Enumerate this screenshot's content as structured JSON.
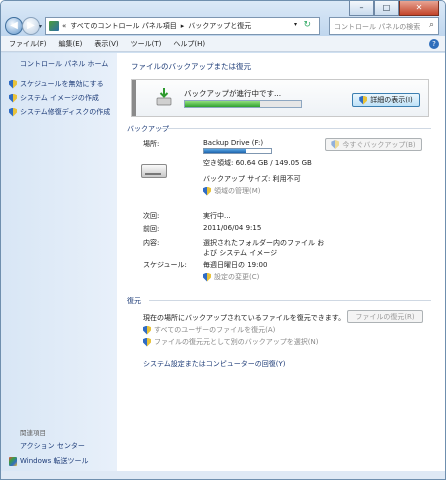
{
  "address": {
    "crumbs": [
      "«",
      "すべてのコントロール パネル項目",
      "▸",
      "バックアップと復元"
    ]
  },
  "search": {
    "placeholder": "コントロール パネルの検索"
  },
  "menu": [
    "ファイル(F)",
    "編集(E)",
    "表示(V)",
    "ツール(T)",
    "ヘルプ(H)"
  ],
  "sidebar": {
    "home": "コントロール パネル ホーム",
    "links": [
      "スケジュールを無効にする",
      "システム イメージの作成",
      "システム修復ディスクの作成"
    ],
    "related_title": "関連項目",
    "related": [
      "アクション センター",
      "Windows 転送ツール"
    ]
  },
  "main": {
    "title": "ファイルのバックアップまたは復元",
    "progress": {
      "message": "バックアップが進行中です...",
      "fraction": 0.65,
      "details_button": "詳細の表示(I)"
    },
    "backup": {
      "heading": "バックアップ",
      "location_label": "場所:",
      "drive_name": "Backup Drive (F:)",
      "capacity_used_fraction": 0.62,
      "free_space": "空き領域: 60.64 GB / 149.05 GB",
      "backup_size": "バックアップ サイズ: 利用不可",
      "manage_space": "領域の管理(M)",
      "backup_now_button": "今すぐバックアップ(B)",
      "next_label": "次回:",
      "next_value": "実行中...",
      "last_label": "前回:",
      "last_value": "2011/06/04 9:15",
      "contents_label": "内容:",
      "contents_value_1": "選択されたフォルダー内のファイル お",
      "contents_value_2": "よび システム イメージ",
      "schedule_label": "スケジュール:",
      "schedule_value": "毎週日曜日の 19:00",
      "change_settings": "設定の変更(C)"
    },
    "restore": {
      "heading": "復元",
      "description": "現在の場所にバックアップされているファイルを復元できます。",
      "restore_button": "ファイルの復元(R)",
      "all_users": "すべてのユーザーのファイルを復元(A)",
      "select_other": "ファイルの復元元として別のバックアップを選択(N)",
      "recover_link": "システム設定またはコンピューターの回復(Y)"
    }
  },
  "colors": {
    "accent": "#1e3c78",
    "progress": "#2fa12f",
    "sidebar": "#dae7f5"
  }
}
